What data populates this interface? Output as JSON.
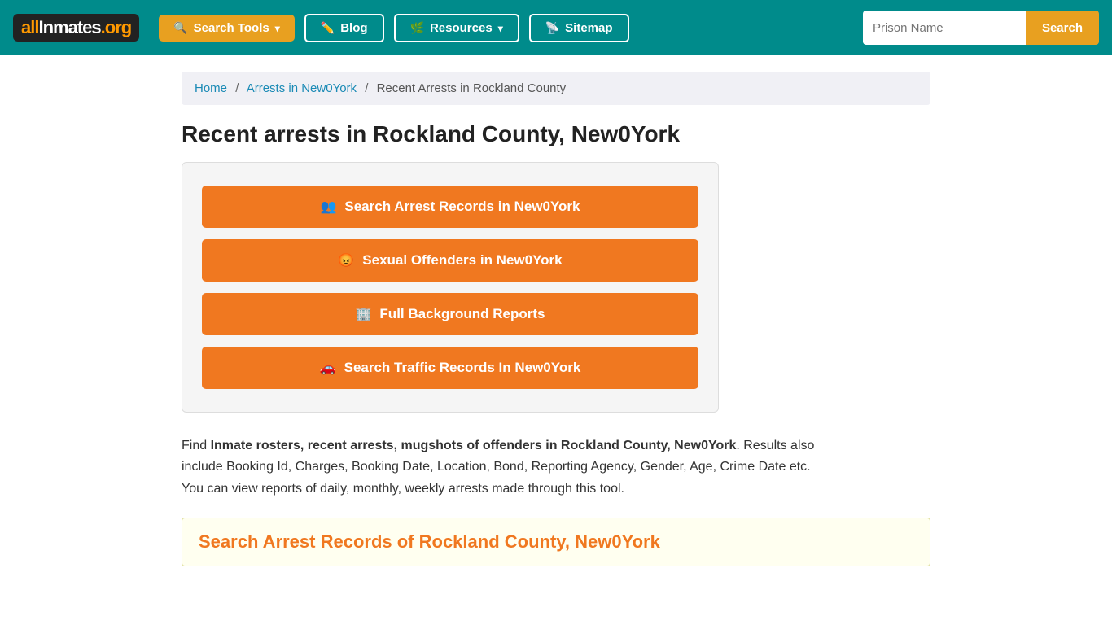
{
  "header": {
    "logo": {
      "part1": "all",
      "part2": "Inmates",
      "part3": ".org"
    },
    "nav": [
      {
        "id": "search-tools",
        "label": "Search Tools",
        "icon": "search",
        "dropdown": true
      },
      {
        "id": "blog",
        "label": "Blog",
        "icon": "blog",
        "dropdown": false
      },
      {
        "id": "resources",
        "label": "Resources",
        "icon": "resources",
        "dropdown": true
      },
      {
        "id": "sitemap",
        "label": "Sitemap",
        "icon": "sitemap",
        "dropdown": false
      }
    ],
    "search": {
      "placeholder": "Prison Name",
      "button_label": "Search"
    }
  },
  "breadcrumb": {
    "items": [
      {
        "label": "Home",
        "href": "#"
      },
      {
        "label": "Arrests in New0York",
        "href": "#"
      },
      {
        "label": "Recent Arrests in Rockland County",
        "href": null
      }
    ]
  },
  "page": {
    "title": "Recent arrests in Rockland County, New0York",
    "action_buttons": [
      {
        "id": "arrest-records",
        "label": "Search Arrest Records in New0York",
        "icon": "people"
      },
      {
        "id": "sex-offenders",
        "label": "Sexual Offenders in New0York",
        "icon": "angry"
      },
      {
        "id": "background-reports",
        "label": "Full Background Reports",
        "icon": "building"
      },
      {
        "id": "traffic-records",
        "label": "Search Traffic Records In New0York",
        "icon": "car"
      }
    ],
    "description_intro": "Find ",
    "description_bold": "Inmate rosters, recent arrests, mugshots of offenders in Rockland County, New0York",
    "description_rest": ". Results also include Booking Id, Charges, Booking Date, Location, Bond, Reporting Agency, Gender, Age, Crime Date etc. You can view reports of daily, monthly, weekly arrests made through this tool.",
    "section_heading": "Search Arrest Records of Rockland County, New0York"
  }
}
